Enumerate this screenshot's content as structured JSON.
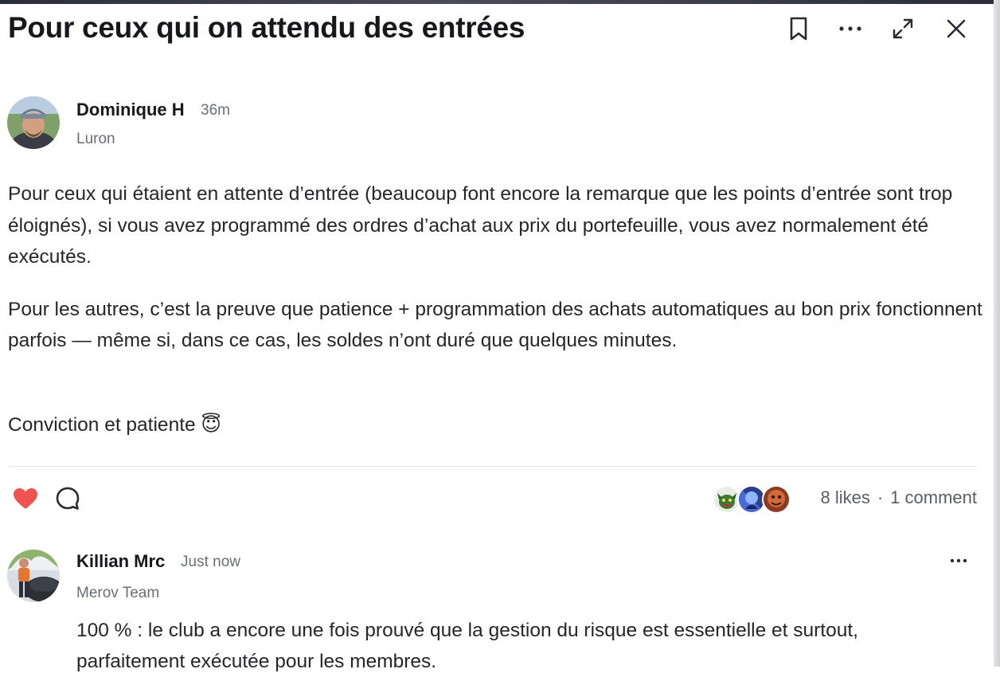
{
  "post": {
    "title": "Pour ceux qui on attendu des entrées",
    "author": {
      "name": "Dominique H",
      "time": "36m",
      "role": "Luron"
    },
    "paragraphs": [
      "Pour ceux qui étaient en attente d’entrée (beaucoup font encore la remarque que les points d’entrée sont trop éloignés), si vous avez programmé des ordres d’achat aux prix du portefeuille, vous avez normalement été exécutés.",
      "Pour les autres, c’est la preuve que patience + programmation des achats automatiques au bon prix fonctionnent parfois — même si, dans ce cas, les soldes n’ont duré que quelques minutes.",
      "Conviction et patiente 😇"
    ],
    "likes": "8 likes",
    "separator": "·",
    "comments": "1 comment"
  },
  "comment": {
    "author": "Killian Mrc",
    "time": "Just now",
    "role": "Merov Team",
    "text": "100 % : le club a encore une fois prouvé que la gestion du risque est essentielle et surtout, parfaitement exécutée pour les membres."
  },
  "icons": {
    "bookmark": "bookmark-icon",
    "more": "more-icon",
    "expand": "expand-icon",
    "close": "close-icon",
    "heart": "heart-icon",
    "comment": "comment-icon"
  },
  "colors": {
    "heart": "#ef5350",
    "muted": "#6b6e76",
    "text": "#1f2024"
  }
}
